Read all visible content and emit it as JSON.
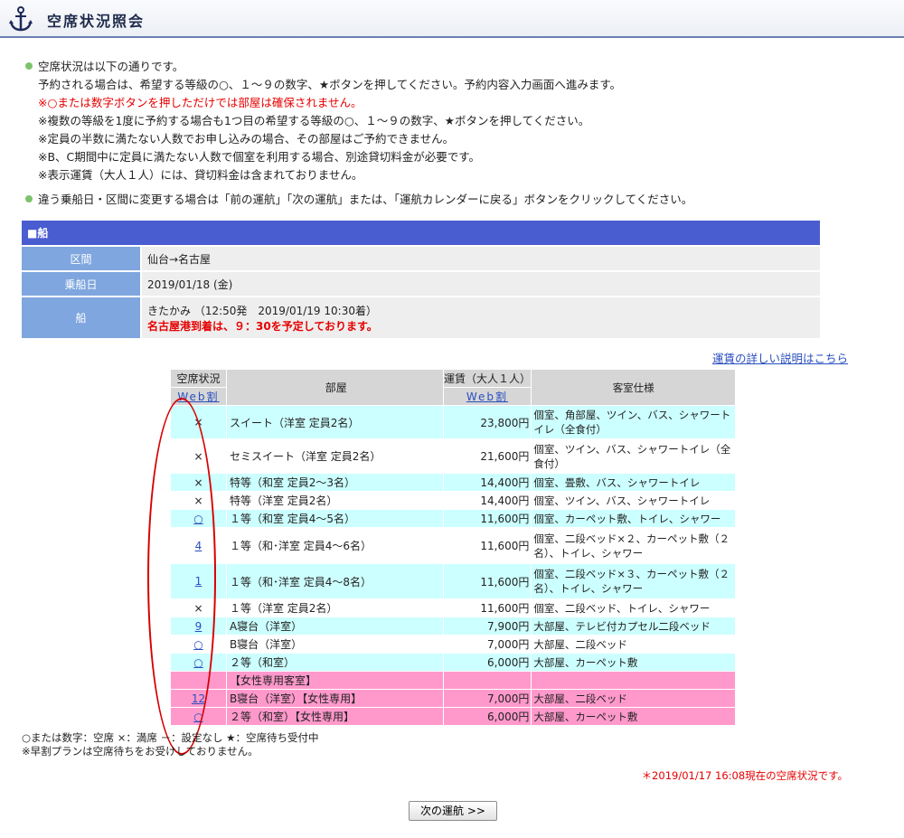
{
  "header": {
    "title": "空席状況照会",
    "icon": "anchor-icon"
  },
  "notes": {
    "lead": "空席状況は以下の通りです。",
    "lines": [
      {
        "text": "予約される場合は、希望する等級の○、１～９の数字、★ボタンを押してください。予約内容入力画面へ進みます。",
        "color": "normal"
      },
      {
        "text": "※○または数字ボタンを押しただけでは部屋は確保されません。",
        "color": "red"
      },
      {
        "text": "※複数の等級を1度に予約する場合も1つ目の希望する等級の○、１～９の数字、★ボタンを押してください。",
        "color": "normal"
      },
      {
        "text": "※定員の半数に満たない人数でお申し込みの場合、その部屋はご予約できません。",
        "color": "normal"
      },
      {
        "text": "※B、C期間中に定員に満たない人数で個室を利用する場合、別途貸切料金が必要です。",
        "color": "normal"
      },
      {
        "text": "※表示運賃（大人１人）には、貸切料金は含まれておりません。",
        "color": "normal"
      }
    ],
    "second": "違う乗船日・区間に変更する場合は「前の運航」「次の運航」または、「運航カレンダーに戻る」ボタンをクリックしてください。"
  },
  "ship": {
    "heading": "■船",
    "route_label": "区間",
    "route_value": "仙台→名古屋",
    "date_label": "乗船日",
    "date_value": "2019/01/18 (金)",
    "ship_label": "船",
    "ship_value": "きたかみ （12:50発　2019/01/19 10:30着）",
    "ship_note": "名古屋港到着は、９：30を予定しております。"
  },
  "fare_link": "運賃の詳しい説明はこちら",
  "table": {
    "headers": {
      "status": "空席状況",
      "status_sub": "Web割",
      "room": "部屋",
      "fare": "運賃（大人１人）",
      "fare_sub": "Web割",
      "spec": "客室仕様"
    },
    "rows": [
      {
        "status": "×",
        "link": false,
        "room": "スイート（洋室 定員2名）",
        "fare": "23,800円",
        "spec": "個室、角部屋、ツイン、バス、シャワートイレ（全食付）",
        "bg": "cyan"
      },
      {
        "status": "×",
        "link": false,
        "room": "セミスイート（洋室 定員2名）",
        "fare": "21,600円",
        "spec": "個室、ツイン、バス、シャワートイレ（全食付）",
        "bg": "white"
      },
      {
        "status": "×",
        "link": false,
        "room": "特等（和室 定員2～3名）",
        "fare": "14,400円",
        "spec": "個室、畳敷、バス、シャワートイレ",
        "bg": "cyan"
      },
      {
        "status": "×",
        "link": false,
        "room": "特等（洋室 定員2名）",
        "fare": "14,400円",
        "spec": "個室、ツイン、バス、シャワートイレ",
        "bg": "white"
      },
      {
        "status": "○",
        "link": true,
        "room": "１等（和室 定員4～5名）",
        "fare": "11,600円",
        "spec": "個室、カーペット敷、トイレ、シャワー",
        "bg": "cyan"
      },
      {
        "status": "4",
        "link": true,
        "room": "１等（和･洋室 定員4～6名）",
        "fare": "11,600円",
        "spec": "個室、二段ベッド×２、カーペット敷（２名）、トイレ、シャワー",
        "bg": "white"
      },
      {
        "status": "1",
        "link": true,
        "room": "１等（和･洋室 定員4～8名）",
        "fare": "11,600円",
        "spec": "個室、二段ベッド×３、カーペット敷（２名）、トイレ、シャワー",
        "bg": "cyan"
      },
      {
        "status": "×",
        "link": false,
        "room": "１等（洋室 定員2名）",
        "fare": "11,600円",
        "spec": "個室、二段ベッド、トイレ、シャワー",
        "bg": "white"
      },
      {
        "status": "9",
        "link": true,
        "room": "A寝台（洋室）",
        "fare": "7,900円",
        "spec": "大部屋、テレビ付カプセル二段ベッド",
        "bg": "cyan"
      },
      {
        "status": "○",
        "link": true,
        "room": "B寝台（洋室）",
        "fare": "7,000円",
        "spec": "大部屋、二段ベッド",
        "bg": "white"
      },
      {
        "status": "○",
        "link": true,
        "room": "２等（和室）",
        "fare": "6,000円",
        "spec": "大部屋、カーペット敷",
        "bg": "cyan"
      },
      {
        "status": "",
        "link": false,
        "room": "【女性専用客室】",
        "fare": "",
        "spec": "",
        "bg": "pink"
      },
      {
        "status": "12",
        "link": true,
        "room": "B寝台（洋室）【女性専用】",
        "fare": "7,000円",
        "spec": "大部屋、二段ベッド",
        "bg": "pink"
      },
      {
        "status": "○",
        "link": true,
        "room": "２等（和室）【女性専用】",
        "fare": "6,000円",
        "spec": "大部屋、カーペット敷",
        "bg": "pink"
      }
    ]
  },
  "legend": {
    "line1": "○または数字：空席 ×：満席 －：設定なし ★：空席待ち受付中",
    "line2": "※早割プランは空席待ちをお受けしておりません。"
  },
  "status_time": "＊2019/01/17 16:08現在の空席状況です。",
  "next_button": "次の運航 >>",
  "colors": {
    "header_bar": "#4a5dd0",
    "label_cell": "#7fa6de",
    "cyan_row": "#ccffff",
    "pink_row": "#ff99cc",
    "note_red": "#e60000",
    "annotation_oval": "#d80000"
  }
}
